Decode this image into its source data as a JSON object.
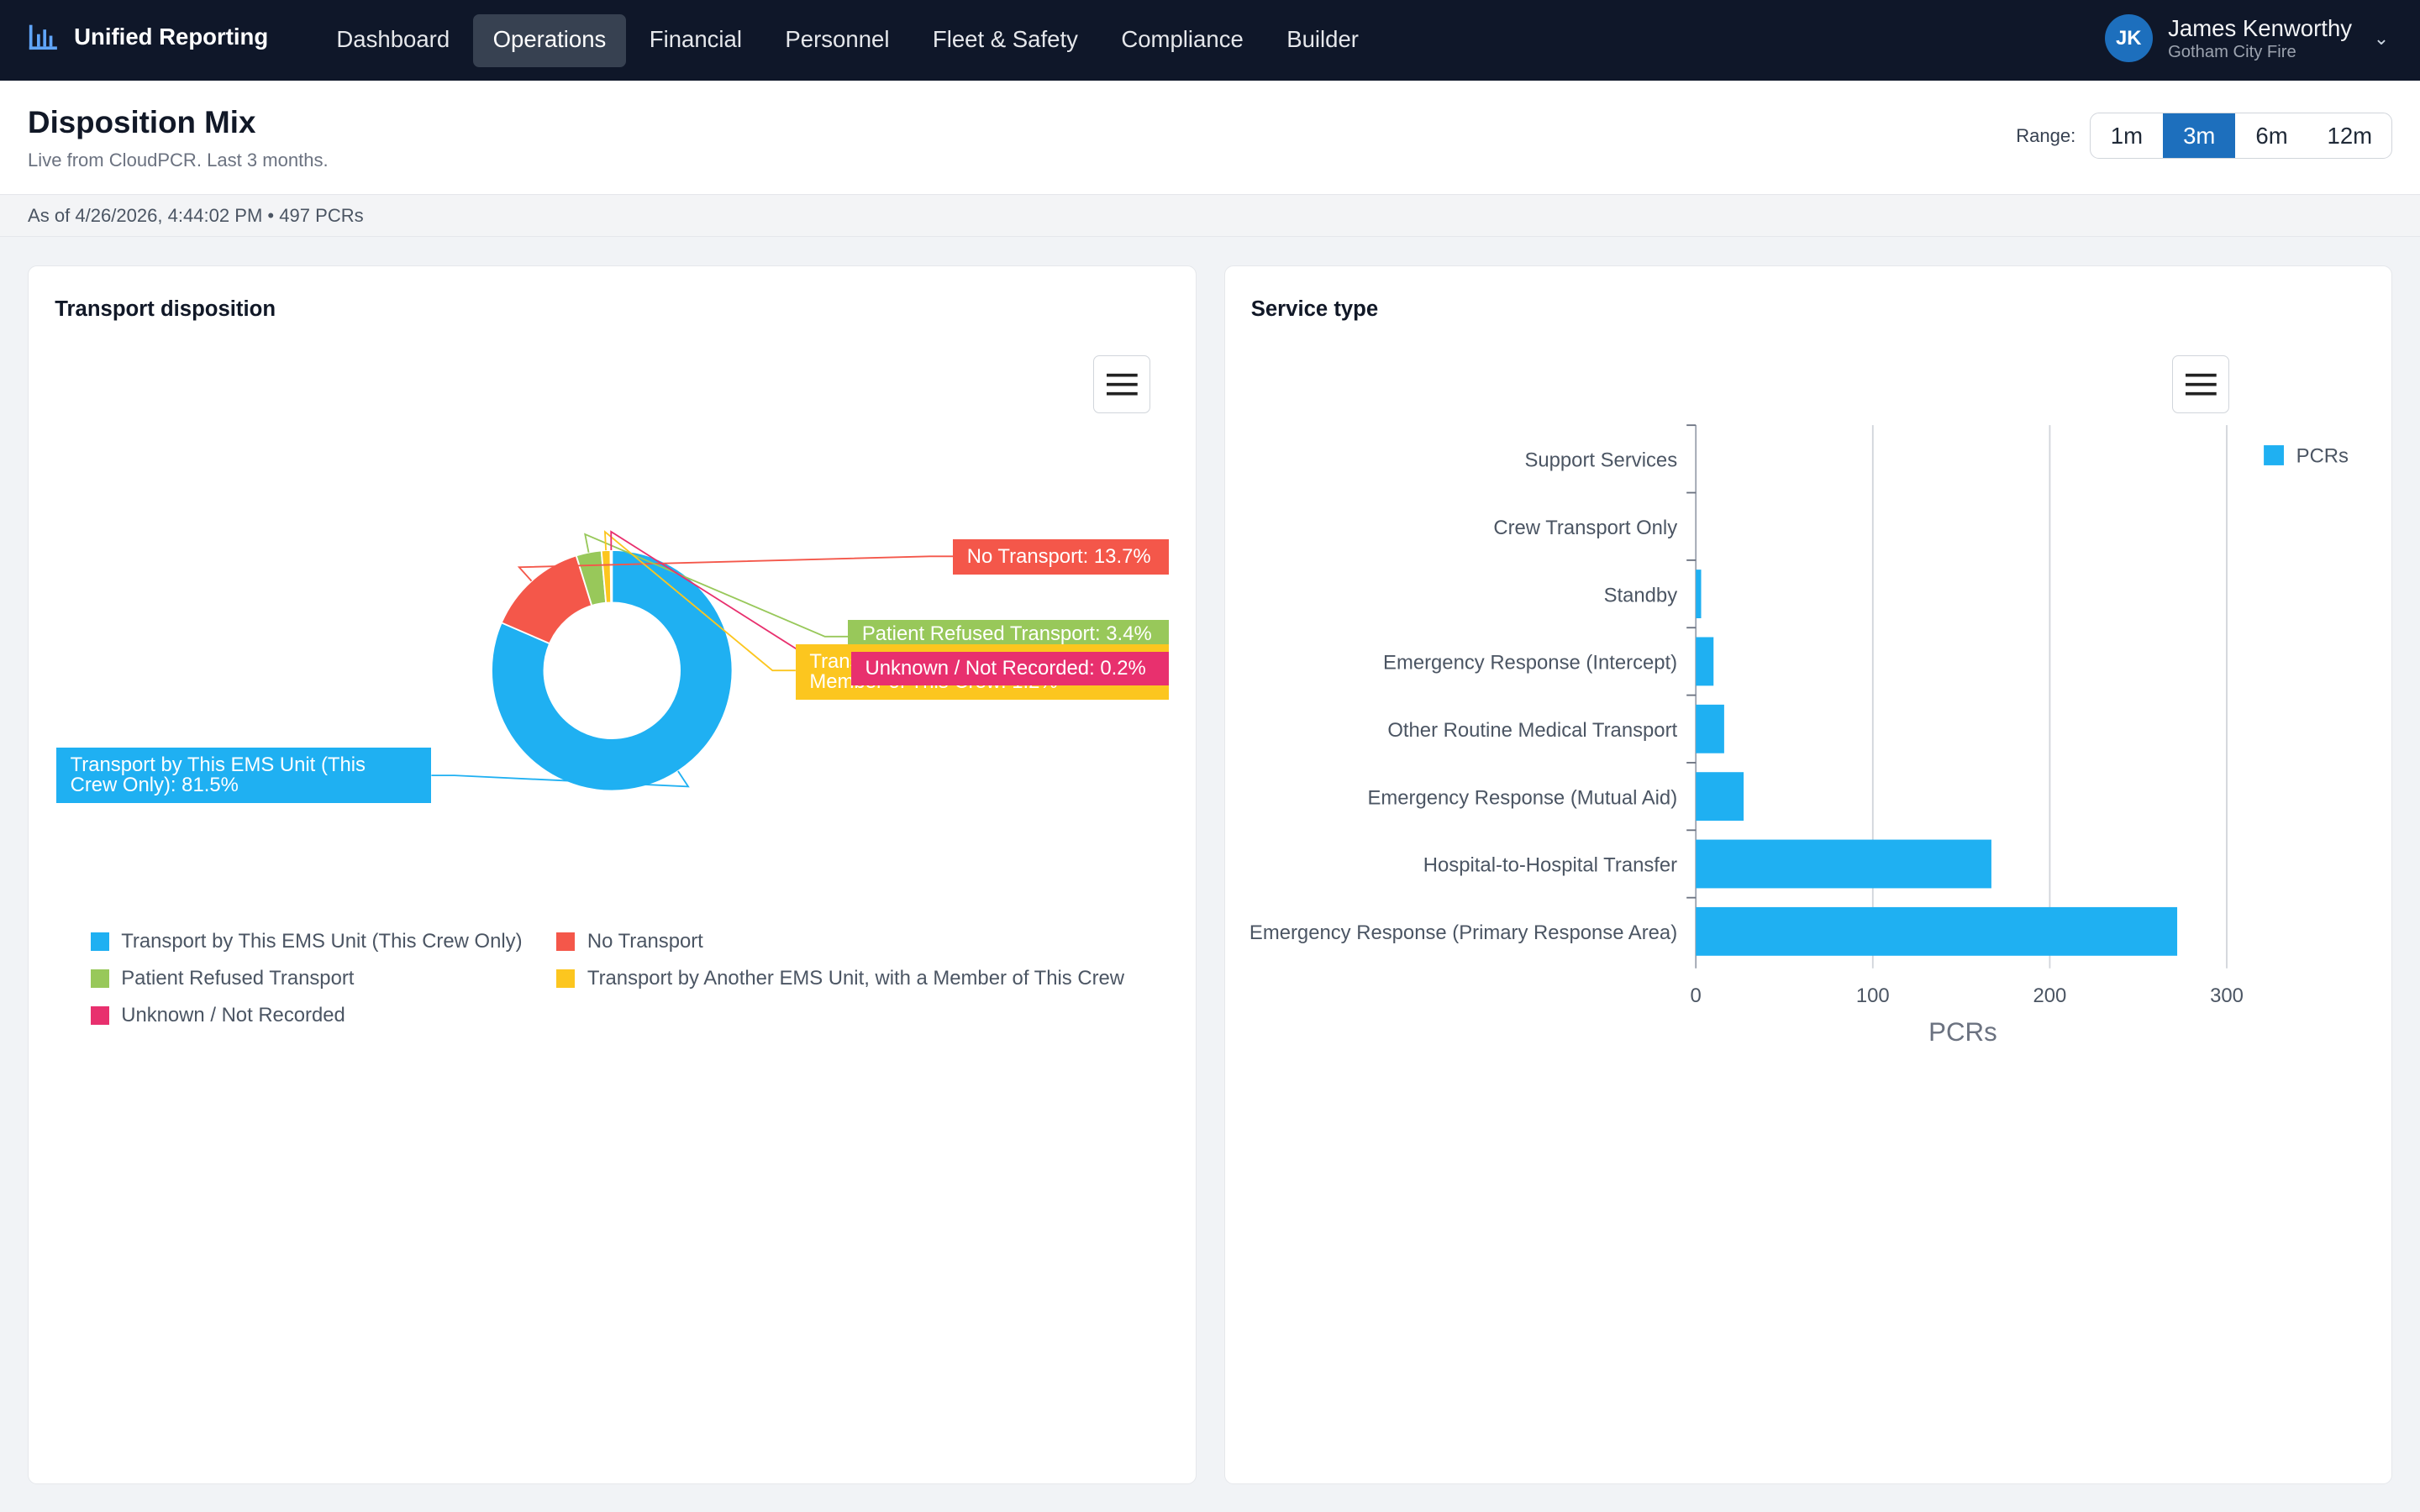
{
  "app": {
    "title": "Unified Reporting",
    "logo_icon": "bar-chart-icon"
  },
  "nav": {
    "items": [
      {
        "label": "Dashboard",
        "active": false
      },
      {
        "label": "Operations",
        "active": true
      },
      {
        "label": "Financial",
        "active": false
      },
      {
        "label": "Personnel",
        "active": false
      },
      {
        "label": "Fleet & Safety",
        "active": false
      },
      {
        "label": "Compliance",
        "active": false
      },
      {
        "label": "Builder",
        "active": false
      }
    ]
  },
  "user": {
    "initials": "JK",
    "name": "James Kenworthy",
    "org": "Gotham City Fire"
  },
  "page": {
    "title": "Disposition Mix",
    "subtitle": "Live from CloudPCR. Last 3 months.",
    "as_of": "As of 4/26/2026, 4:44:02 PM • 497 PCRs"
  },
  "range": {
    "label": "Range:",
    "options": [
      "1m",
      "3m",
      "6m",
      "12m"
    ],
    "selected": "3m"
  },
  "cards": {
    "disposition_title": "Transport disposition",
    "service_title": "Service type"
  },
  "colors": {
    "accent": "#1d6fbd",
    "blue": "#1fb0f2",
    "red": "#f4574a",
    "green": "#98c85a",
    "yellow": "#fcc61f",
    "pink": "#e8306e"
  },
  "chart_data": [
    {
      "type": "pie",
      "title": "Transport disposition",
      "donut": true,
      "slices": [
        {
          "label": "Transport by This EMS Unit (This Crew Only)",
          "value": 81.5,
          "color": "#1fb0f2",
          "data_label": "Transport by This EMS Unit (This Crew Only): 81.5%"
        },
        {
          "label": "No Transport",
          "value": 13.7,
          "color": "#f4574a",
          "data_label": "No Transport: 13.7%"
        },
        {
          "label": "Patient Refused Transport",
          "value": 3.4,
          "color": "#98c85a",
          "data_label": "Patient Refused Transport: 3.4%"
        },
        {
          "label": "Transport by Another EMS Unit, with a Member of This Crew",
          "value": 1.2,
          "color": "#fcc61f",
          "data_label": "Transport by Another EMS Unit, with a Member of This Crew: 1.2%"
        },
        {
          "label": "Unknown / Not Recorded",
          "value": 0.2,
          "color": "#e8306e",
          "data_label": "Unknown / Not Recorded: 0.2%"
        }
      ],
      "legend_placement": "bottom"
    },
    {
      "type": "bar",
      "orientation": "horizontal",
      "title": "Service type",
      "categories": [
        "Support Services",
        "Crew Transport Only",
        "Standby",
        "Emergency Response (Intercept)",
        "Other Routine Medical Transport",
        "Emergency Response (Mutual Aid)",
        "Hospital-to-Hospital Transfer",
        "Emergency Response (Primary Response Area)"
      ],
      "series": [
        {
          "name": "PCRs",
          "color": "#1fb0f2",
          "values": [
            0,
            0,
            3,
            10,
            16,
            27,
            167,
            272
          ]
        }
      ],
      "xlabel": "PCRs",
      "xlim": [
        0,
        300
      ],
      "xticks": [
        "0",
        "100",
        "200",
        "300"
      ],
      "grid": true,
      "legend_placement": "top-right"
    }
  ]
}
